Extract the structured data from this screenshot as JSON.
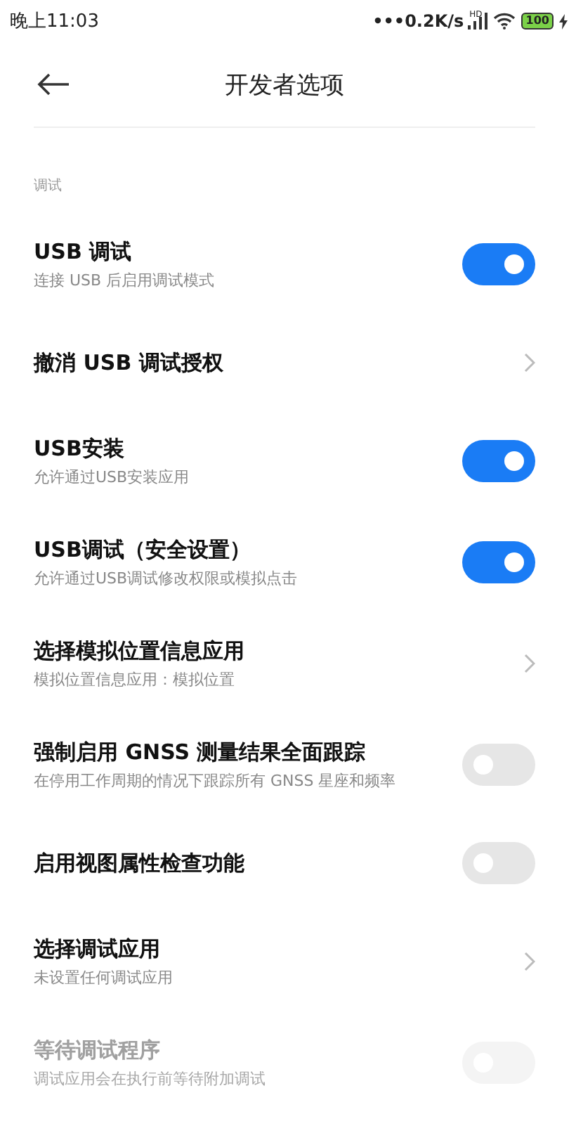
{
  "status_bar": {
    "time": "晚上11:03",
    "speed": "•••0.2K/s",
    "network_label": "HD",
    "battery": "100",
    "charging": true
  },
  "header": {
    "title": "开发者选项"
  },
  "section": {
    "label": "调试"
  },
  "items": [
    {
      "kind": "toggle",
      "title": "USB 调试",
      "subtitle": "连接 USB 后启用调试模式",
      "on": true,
      "disabled": false
    },
    {
      "kind": "link",
      "title": "撤消 USB 调试授权",
      "disabled": false
    },
    {
      "kind": "toggle",
      "title": "USB安装",
      "subtitle": "允许通过USB安装应用",
      "on": true,
      "disabled": false
    },
    {
      "kind": "toggle",
      "title": "USB调试（安全设置）",
      "subtitle": "允许通过USB调试修改权限或模拟点击",
      "on": true,
      "disabled": false
    },
    {
      "kind": "link",
      "title": "选择模拟位置信息应用",
      "subtitle": "模拟位置信息应用：模拟位置",
      "disabled": false
    },
    {
      "kind": "toggle",
      "title": "强制启用 GNSS 测量结果全面跟踪",
      "subtitle": "在停用工作周期的情况下跟踪所有 GNSS 星座和频率",
      "on": false,
      "disabled": false
    },
    {
      "kind": "toggle",
      "title": "启用视图属性检查功能",
      "on": false,
      "disabled": false
    },
    {
      "kind": "link",
      "title": "选择调试应用",
      "subtitle": "未设置任何调试应用",
      "disabled": false
    },
    {
      "kind": "toggle",
      "title": "等待调试程序",
      "subtitle": "调试应用会在执行前等待附加调试",
      "on": false,
      "disabled": true
    }
  ]
}
